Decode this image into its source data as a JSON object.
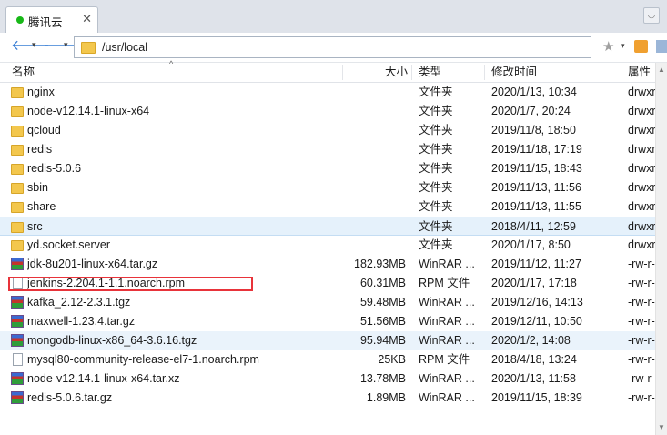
{
  "tab": {
    "title": "腾讯云",
    "close": "✕"
  },
  "nav": {
    "path": "/usr/local"
  },
  "columns": {
    "name": "名称",
    "size": "大小",
    "type": "类型",
    "modified": "修改时间",
    "attr": "属性"
  },
  "files": [
    {
      "name": "nginx",
      "size": "",
      "type": "文件夹",
      "modified": "2020/1/13, 10:34",
      "attr": "drwxr",
      "icon": "folder-icon"
    },
    {
      "name": "node-v12.14.1-linux-x64",
      "size": "",
      "type": "文件夹",
      "modified": "2020/1/7, 20:24",
      "attr": "drwxr",
      "icon": "folder-icon"
    },
    {
      "name": "qcloud",
      "size": "",
      "type": "文件夹",
      "modified": "2019/11/8, 18:50",
      "attr": "drwxr",
      "icon": "folder-icon"
    },
    {
      "name": "redis",
      "size": "",
      "type": "文件夹",
      "modified": "2019/11/18, 17:19",
      "attr": "drwxr",
      "icon": "folder-icon"
    },
    {
      "name": "redis-5.0.6",
      "size": "",
      "type": "文件夹",
      "modified": "2019/11/15, 18:43",
      "attr": "drwxr",
      "icon": "folder-icon"
    },
    {
      "name": "sbin",
      "size": "",
      "type": "文件夹",
      "modified": "2019/11/13, 11:56",
      "attr": "drwxr",
      "icon": "folder-icon"
    },
    {
      "name": "share",
      "size": "",
      "type": "文件夹",
      "modified": "2019/11/13, 11:55",
      "attr": "drwxr",
      "icon": "folder-icon"
    },
    {
      "name": "src",
      "size": "",
      "type": "文件夹",
      "modified": "2018/4/11, 12:59",
      "attr": "drwxr",
      "icon": "folder-icon",
      "selected": true
    },
    {
      "name": "yd.socket.server",
      "size": "",
      "type": "文件夹",
      "modified": "2020/1/17, 8:50",
      "attr": "drwxr",
      "icon": "folder-icon"
    },
    {
      "name": "jdk-8u201-linux-x64.tar.gz",
      "size": "182.93MB",
      "type": "WinRAR ...",
      "modified": "2019/11/12, 11:27",
      "attr": "-rw-r-",
      "icon": "archive-icon"
    },
    {
      "name": "jenkins-2.204.1-1.1.noarch.rpm",
      "size": "60.31MB",
      "type": "RPM 文件",
      "modified": "2020/1/17, 17:18",
      "attr": "-rw-r-",
      "icon": "file-icon",
      "highlighted": true
    },
    {
      "name": "kafka_2.12-2.3.1.tgz",
      "size": "59.48MB",
      "type": "WinRAR ...",
      "modified": "2019/12/16, 14:13",
      "attr": "-rw-r-",
      "icon": "archive-icon"
    },
    {
      "name": "maxwell-1.23.4.tar.gz",
      "size": "51.56MB",
      "type": "WinRAR ...",
      "modified": "2019/12/11, 10:50",
      "attr": "-rw-r-",
      "icon": "archive-icon"
    },
    {
      "name": "mongodb-linux-x86_64-3.6.16.tgz",
      "size": "95.94MB",
      "type": "WinRAR ...",
      "modified": "2020/1/2, 14:08",
      "attr": "-rw-r-",
      "icon": "archive-icon",
      "hovered": true
    },
    {
      "name": "mysql80-community-release-el7-1.noarch.rpm",
      "size": "25KB",
      "type": "RPM 文件",
      "modified": "2018/4/18, 13:24",
      "attr": "-rw-r-",
      "icon": "file-icon"
    },
    {
      "name": "node-v12.14.1-linux-x64.tar.xz",
      "size": "13.78MB",
      "type": "WinRAR ...",
      "modified": "2020/1/13, 11:58",
      "attr": "-rw-r-",
      "icon": "archive-icon"
    },
    {
      "name": "redis-5.0.6.tar.gz",
      "size": "1.89MB",
      "type": "WinRAR ...",
      "modified": "2019/11/15, 18:39",
      "attr": "-rw-r-",
      "icon": "archive-icon"
    }
  ],
  "colors": {
    "folder": "#f3c74d",
    "selection": "#e5f1fb",
    "highlight": "#e8333a",
    "accent": "#3a7fd5"
  }
}
